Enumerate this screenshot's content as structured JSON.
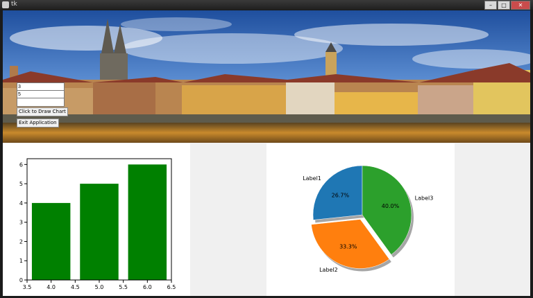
{
  "window": {
    "title": "tk"
  },
  "controls": {
    "entry1_value": "3",
    "entry2_value": "5",
    "entry3_value": "",
    "draw_button_label": "Click to Draw Chart",
    "exit_button_label": "Exit Application"
  },
  "colors": {
    "bar": "#008000",
    "pie": [
      "#1f77b4",
      "#ff7f0e",
      "#2ca02c"
    ]
  },
  "chart_data": [
    {
      "type": "bar",
      "x": [
        4.0,
        5.0,
        6.0
      ],
      "values": [
        4,
        5,
        6
      ],
      "xlim": [
        3.5,
        6.5
      ],
      "ylim": [
        0,
        6.3
      ],
      "xticks": [
        "3.5",
        "4.0",
        "4.5",
        "5.0",
        "5.5",
        "6.0",
        "6.5"
      ],
      "yticks": [
        "0",
        "1",
        "2",
        "3",
        "4",
        "5",
        "6"
      ],
      "title": "",
      "xlabel": "",
      "ylabel": ""
    },
    {
      "type": "pie",
      "labels": [
        "Label1",
        "Label2",
        "Label3"
      ],
      "values": [
        4,
        5,
        6
      ],
      "pct_labels": [
        "26.7%",
        "33.3%",
        "40.0%"
      ],
      "explode": [
        0,
        0.1,
        0
      ],
      "shadow": true,
      "start_angle": 90
    }
  ]
}
